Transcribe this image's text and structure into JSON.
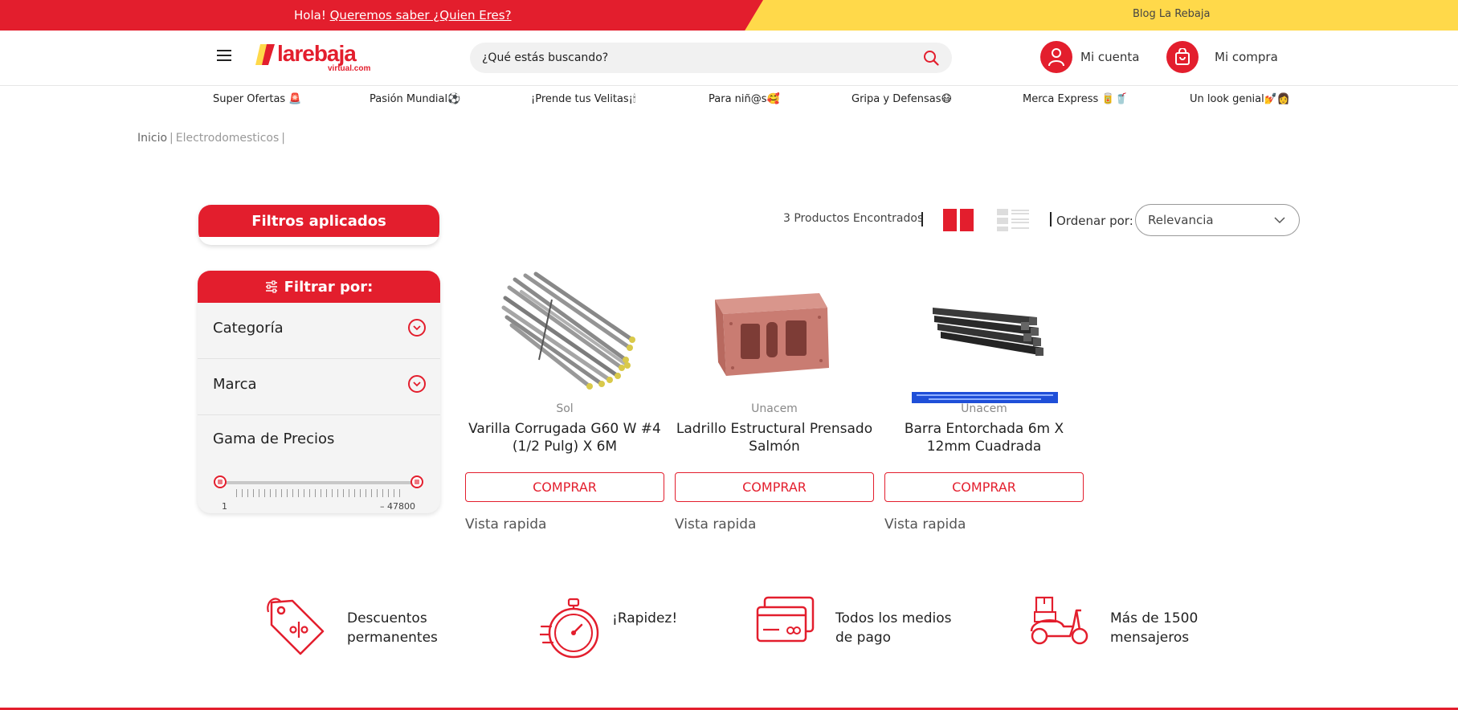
{
  "promo": {
    "hello": "Hola!",
    "link": "Queremos saber ¿Quien Eres?",
    "blog": "Blog La Rebaja"
  },
  "header": {
    "logo_text": "larebaja",
    "logo_sub": "virtual.com",
    "search_placeholder": "¿Qué estás buscando?",
    "account_label": "Mi cuenta",
    "cart_label": "Mi compra"
  },
  "nav": [
    "Super Ofertas 🚨",
    "Pasión Mundial⚽",
    "¡Prende tus Velitas¡🕯",
    "Para niñ@s🥰",
    "Gripa y Defensas😷",
    "Merca Express 🥫🥤",
    "Un look genial💅👩"
  ],
  "breadcrumb": {
    "home": "Inicio",
    "current": "Electrodomesticos"
  },
  "filters": {
    "applied_title": "Filtros aplicados",
    "filter_title": "Filtrar por:",
    "category": "Categoría",
    "brand": "Marca",
    "price_range": "Gama de Precios",
    "price_min": "1",
    "price_max": "– 47800"
  },
  "results": {
    "count": "3 Productos Encontrados",
    "order_label": "Ordenar por:",
    "order_value": "Relevancia"
  },
  "products": [
    {
      "brand": "Sol",
      "name": "Varilla Corrugada G60 W #4 (1/2 Pulg) X 6M",
      "buy": "COMPRAR",
      "quick": "Vista rapida"
    },
    {
      "brand": "Unacem",
      "name": "Ladrillo Estructural Prensado Salmón",
      "buy": "COMPRAR",
      "quick": "Vista rapida"
    },
    {
      "brand": "Unacem",
      "name": "Barra Entorchada 6m X 12mm Cuadrada",
      "buy": "COMPRAR",
      "quick": "Vista rapida"
    }
  ],
  "benefits": [
    {
      "text": "Descuentos permanentes",
      "icon": "discount-tag-icon"
    },
    {
      "text": "¡Rapidez!",
      "icon": "stopwatch-icon"
    },
    {
      "text": "Todos los medios de pago",
      "icon": "credit-card-icon"
    },
    {
      "text": "Más de 1500 mensajeros",
      "icon": "delivery-scooter-icon"
    }
  ],
  "colors": {
    "brand_red": "#e31e2d",
    "brand_yellow": "#ffd94a"
  }
}
